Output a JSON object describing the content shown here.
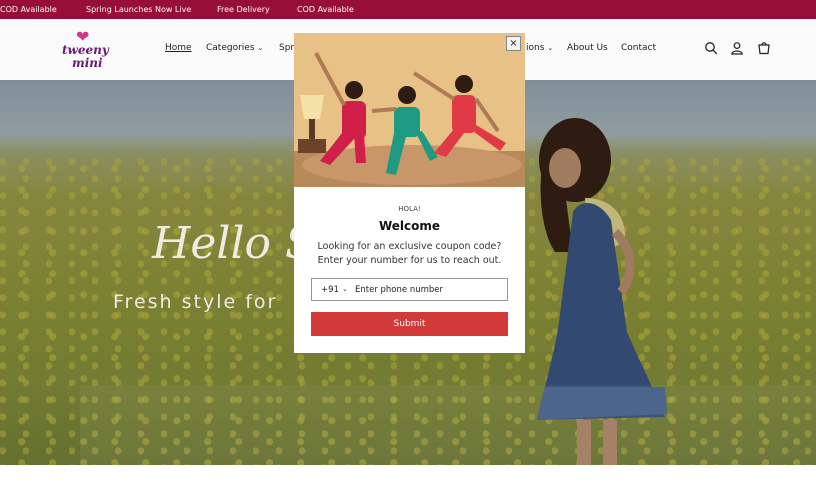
{
  "announcement": {
    "items": [
      "COD Available",
      "Spring Launches Now Live",
      "Free Delivery",
      "COD Available"
    ]
  },
  "header": {
    "logo_line1": "tweeny",
    "logo_line2": "mini",
    "nav": {
      "home": "Home",
      "categories": "Categories",
      "spring": "Spr",
      "collections": "ions",
      "about": "About Us",
      "contact": "Contact"
    }
  },
  "hero": {
    "script_text": "Hello S",
    "subtitle": "Fresh style for"
  },
  "popup": {
    "close_label": "×",
    "eyebrow": "HOLA!",
    "title": "Welcome",
    "description": "Looking for an exclusive coupon code? Enter your number for us to reach out.",
    "country_code": "+91",
    "phone_placeholder": "Enter phone number",
    "submit_label": "Submit"
  },
  "colors": {
    "announcement_bg": "#970e3a",
    "submit_bg": "#d23a3a",
    "logo": "#6b1a78"
  }
}
